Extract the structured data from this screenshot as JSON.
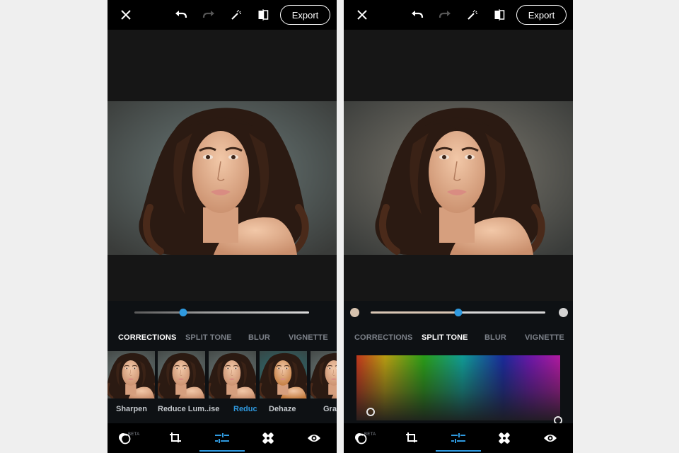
{
  "screens": [
    {
      "id": "corrections-view",
      "topbar": {
        "icons": [
          "close-icon",
          "undo-icon",
          "redo-icon",
          "magic-wand-icon",
          "compare-icon"
        ],
        "export_label": "Export"
      },
      "photo": {
        "backdrop": "cool-grey",
        "bg_color": "#6b7a79"
      },
      "slider": {
        "value_fraction": 0.28
      },
      "tabs": [
        {
          "label": "CORRECTIONS",
          "active": true
        },
        {
          "label": "SPLIT TONE",
          "active": false
        },
        {
          "label": "BLUR",
          "active": false
        },
        {
          "label": "VIGNETTE",
          "active": false
        }
      ],
      "presets": [
        {
          "label": "Sharpen",
          "selected": false
        },
        {
          "label": "Reduce Lum..ise",
          "selected": false
        },
        {
          "label": "Reduc",
          "selected": true
        },
        {
          "label": "Dehaze",
          "selected": false
        },
        {
          "label": "Gra",
          "selected": false
        }
      ],
      "bottom_nav": {
        "beta_label": "BETA",
        "items": [
          "looks-icon",
          "crop-icon",
          "adjustments-icon",
          "healing-icon",
          "preview-eye-icon"
        ],
        "active_index": 2
      }
    },
    {
      "id": "split-tone-view",
      "topbar": {
        "icons": [
          "close-icon",
          "undo-icon",
          "redo-icon",
          "magic-wand-icon",
          "compare-icon"
        ],
        "export_label": "Export"
      },
      "photo": {
        "backdrop": "warm-grey",
        "bg_color": "#7e7a70"
      },
      "slider": {
        "value_fraction": 0.5
      },
      "split_tone": {
        "shadow_swatch_color": "#d6c2ae",
        "highlight_swatch_color": "#d3d3d3",
        "shadows_handle": {
          "hue_fraction": 0.07,
          "saturation_fraction": 0.13
        },
        "highlights_handle": {
          "hue_fraction": 0.99,
          "saturation_fraction": 0.0
        }
      },
      "tabs": [
        {
          "label": "CORRECTIONS",
          "active": false
        },
        {
          "label": "SPLIT TONE",
          "active": true
        },
        {
          "label": "BLUR",
          "active": false
        },
        {
          "label": "VIGNETTE",
          "active": false
        }
      ],
      "bottom_nav": {
        "beta_label": "BETA",
        "items": [
          "looks-icon",
          "crop-icon",
          "adjustments-icon",
          "healing-icon",
          "preview-eye-icon"
        ],
        "active_index": 2
      }
    }
  ]
}
